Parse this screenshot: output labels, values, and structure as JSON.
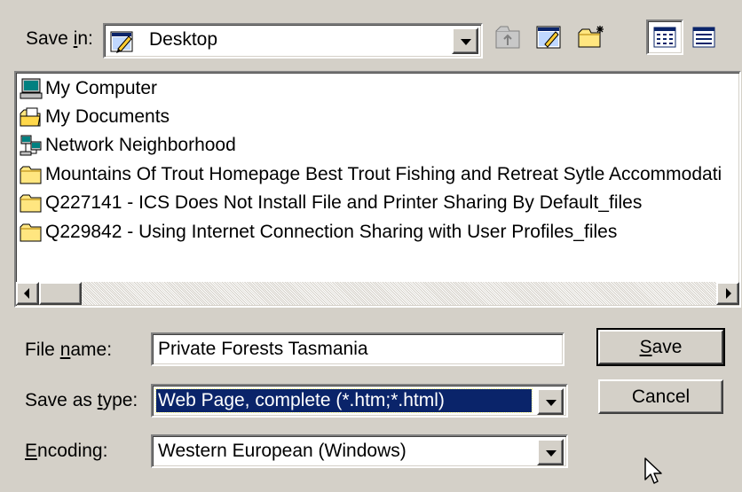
{
  "header": {
    "save_in_label_pre": "Save ",
    "save_in_label_key": "i",
    "save_in_label_post": "n:",
    "location": "Desktop"
  },
  "toolbar": {
    "icons": [
      "up-one-level-icon",
      "desktop-icon",
      "new-folder-icon",
      "list-view-icon",
      "details-view-icon"
    ]
  },
  "file_list": {
    "items": [
      {
        "label": "My Computer",
        "icon": "my-computer-icon"
      },
      {
        "label": "My Documents",
        "icon": "my-documents-icon"
      },
      {
        "label": "Network Neighborhood",
        "icon": "network-neighborhood-icon"
      },
      {
        "label": "Mountains Of Trout Homepage Best Trout Fishing and Retreat Sytle Accommodati",
        "icon": "folder-icon"
      },
      {
        "label": "Q227141 - ICS Does Not Install File and Printer Sharing By Default_files",
        "icon": "folder-icon"
      },
      {
        "label": "Q229842 - Using Internet Connection Sharing with User Profiles_files",
        "icon": "folder-icon"
      }
    ]
  },
  "form": {
    "filename_label_pre": "File ",
    "filename_label_key": "n",
    "filename_label_post": "ame:",
    "filename_value": "Private Forests Tasmania",
    "savetype_label_pre": "Save as ",
    "savetype_label_key": "t",
    "savetype_label_post": "ype:",
    "savetype_value": "Web Page, complete (*.htm;*.html)",
    "encoding_label_key": "E",
    "encoding_label_post": "ncoding:",
    "encoding_value": "Western European (Windows)"
  },
  "buttons": {
    "save_key": "S",
    "save_post": "ave",
    "cancel": "Cancel"
  },
  "colors": {
    "face": "#d4d0c8",
    "selection": "#0a246a"
  }
}
